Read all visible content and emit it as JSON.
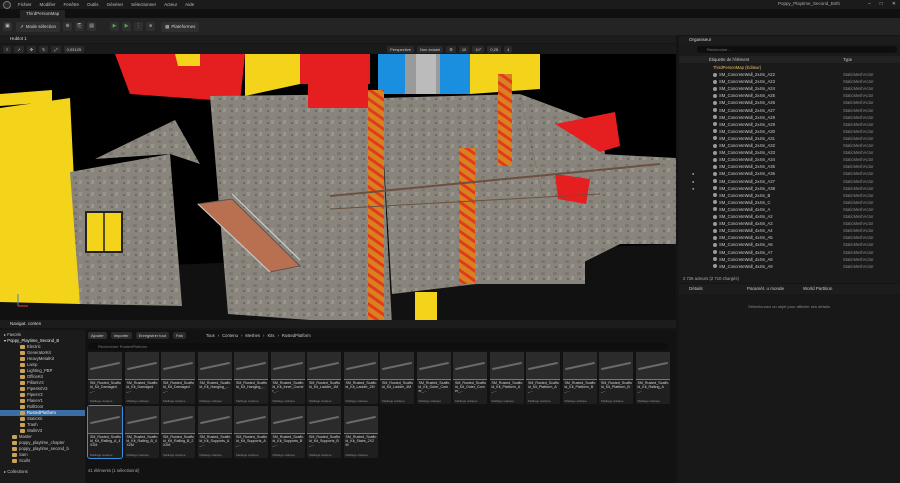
{
  "menu": {
    "items": [
      "Fichier",
      "Modifier",
      "Fenêtre",
      "Outils",
      "Générer",
      "Sélectionner",
      "Acteur",
      "Aide"
    ]
  },
  "window": {
    "title": "Poppy_Playtime_Second_Birth"
  },
  "map_tab": "ThirdPersonMap",
  "toolbar": {
    "mode_label": "Mode sélection",
    "platforms_label": "Plateformes"
  },
  "viewport": {
    "tab": "Hublot 1",
    "speed": "0,03125",
    "perspective": "Perspective",
    "lighting": "Non éclairé",
    "values": [
      "10",
      "10°",
      "0,25",
      "4"
    ],
    "colors": {
      "yellow": "#f4d41a",
      "red": "#e51f1f",
      "blue": "#1a8fe0",
      "concrete": "#8a857c"
    }
  },
  "content_browser": {
    "tab": "Navigat. conten",
    "favorites": "Favoris",
    "project": "Poppy_Playtime_Second_B",
    "add_label": "Ajouter",
    "import_label": "Importer",
    "save_all_label": "Enregistrer tout",
    "fab_label": "Fab",
    "breadcrumb": [
      "Tous",
      "Contenu",
      "Meshes",
      "Kits",
      "RustedPlatform"
    ],
    "search_placeholder": "Rechercher RustedPlatform",
    "folders": [
      "Electric",
      "GeneratorKit",
      "HeavyMetalKit",
      "Lamp",
      "Lighting_PBP",
      "OfficeKit",
      "PillarsV3",
      "PipesKitV3",
      "PipesV3",
      "PlaneV1",
      "RollDoor",
      "RustedPlatform",
      "StaticKit",
      "Trash",
      "WallsV3",
      "Master",
      "poppy_playtime_chapter",
      "poppy_playtime_second_b",
      "Sam",
      "Sculls"
    ],
    "selected_folder": "RustedPlatform",
    "collections": "Collections",
    "status": "41 éléments (1 sélectionné)",
    "assets": [
      {
        "name": "SM_Rusted_Scaffold_Kit_Damaged_..."
      },
      {
        "name": "SM_Rusted_Scaffold_Kit_Damaged_..."
      },
      {
        "name": "SM_Rusted_Scaffold_Kit_Damaged_..."
      },
      {
        "name": "SM_Rusted_Scaffold_Kit_Hanging_..."
      },
      {
        "name": "SM_Rusted_Scaffold_Kit_Hanging_..."
      },
      {
        "name": "SM_Rusted_Scaffold_Kit_Inner_Corner_..."
      },
      {
        "name": "SM_Rusted_Scaffold_Kit_Ladder_1M"
      },
      {
        "name": "SM_Rusted_Scaffold_Kit_Ladder_2M"
      },
      {
        "name": "SM_Rusted_Scaffold_Kit_Ladder_4M"
      },
      {
        "name": "SM_Rusted_Scaffold_Kit_Outer_Corner_..."
      },
      {
        "name": "SM_Rusted_Scaffold_Kit_Outer_Corner_..."
      },
      {
        "name": "SM_Rusted_Scaffold_Kit_Platform_A_..."
      },
      {
        "name": "SM_Rusted_Scaffold_Kit_Platform_A_..."
      },
      {
        "name": "SM_Rusted_Scaffold_Kit_Platform_B_..."
      },
      {
        "name": "SM_Rusted_Scaffold_Kit_Platform_B_..."
      },
      {
        "name": "SM_Rusted_Scaffold_Kit_Railing_A_..."
      },
      {
        "name": "SM_Rusted_Scaffold_Kit_Railing_A_4X2M"
      },
      {
        "name": "SM_Rusted_Scaffold_Kit_Railing_B_4X2M"
      },
      {
        "name": "SM_Rusted_Scaffold_Kit_Railing_B_2X2M"
      },
      {
        "name": "SM_Rusted_Scaffold_Kit_Supports_A_..."
      },
      {
        "name": "SM_Rusted_Scaffold_Kit_Supports_A_..."
      },
      {
        "name": "SM_Rusted_Scaffold_Kit_Supports_B_..."
      },
      {
        "name": "SM_Rusted_Scaffold_Kit_Supports_B_..."
      },
      {
        "name": "SM_Rusted_Scaffold_Kit_Stairs_2X2M"
      }
    ],
    "asset_type": "Maillage statique",
    "selected_index": 16
  },
  "outliner": {
    "tab": "Organiseur",
    "search_placeholder": "Rechercher...",
    "col_label": "Étiquette de l'élément",
    "col_type": "Type",
    "root": "ThirdPersonMap (Éditeur)",
    "rows": [
      "SM_ConcreteWall_2x4m_A22",
      "SM_ConcreteWall_2x4m_A23",
      "SM_ConcreteWall_2x4m_A24",
      "SM_ConcreteWall_2x4m_A25",
      "SM_ConcreteWall_2x4m_A26",
      "SM_ConcreteWall_2x4m_A27",
      "SM_ConcreteWall_2x4m_A28",
      "SM_ConcreteWall_2x4m_A29",
      "SM_ConcreteWall_2x4m_A30",
      "SM_ConcreteWall_2x4m_A31",
      "SM_ConcreteWall_2x4m_A32",
      "SM_ConcreteWall_2x4m_A33",
      "SM_ConcreteWall_2x4m_A34",
      "SM_ConcreteWall_2x4m_A35",
      "SM_ConcreteWall_2x4m_A36",
      "SM_ConcreteWall_2x4m_A37",
      "SM_ConcreteWall_2x4m_A38",
      "SM_ConcreteWall_2x4m_B",
      "SM_ConcreteWall_2x4m_C",
      "SM_ConcreteWall_4x4m_A",
      "SM_ConcreteWall_4x4m_A2",
      "SM_ConcreteWall_4x4m_A3",
      "SM_ConcreteWall_4x4m_A4",
      "SM_ConcreteWall_4x4m_A5",
      "SM_ConcreteWall_4x4m_A6",
      "SM_ConcreteWall_4x4m_A7",
      "SM_ConcreteWall_4x4m_A8",
      "SM_ConcreteWall_4x4m_A9"
    ],
    "row_type": "StaticMeshActor",
    "footer": "2 726 acteurs (2 710 chargés)"
  },
  "details": {
    "tab": "Détails",
    "world_settings_tab": "Paramèt. u monde",
    "world_partition_tab": "World Partition",
    "empty_text": "Sélectionnez un objet pour afficher ses détails."
  }
}
